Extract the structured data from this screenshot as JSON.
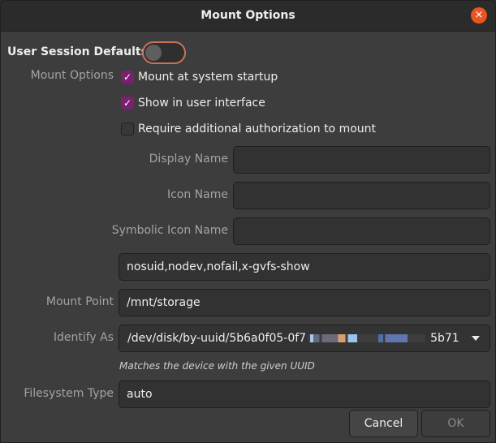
{
  "window": {
    "title": "Mount Options",
    "close_icon": "×"
  },
  "user_session_defaults": {
    "label": "User Session Defaults",
    "enabled": false
  },
  "mount_options": {
    "label": "Mount Options",
    "checkboxes": [
      {
        "label": "Mount at system startup",
        "checked": true,
        "mark": "✓"
      },
      {
        "label": "Show in user interface",
        "checked": true,
        "mark": "✓"
      },
      {
        "label": "Require additional authorization to mount",
        "checked": false,
        "mark": ""
      }
    ]
  },
  "fields": {
    "display_name": {
      "label": "Display Name",
      "value": ""
    },
    "icon_name": {
      "label": "Icon Name",
      "value": ""
    },
    "symbolic_icon_name": {
      "label": "Symbolic Icon Name",
      "value": ""
    },
    "options": {
      "value": "nosuid,nodev,nofail,x-gvfs-show"
    },
    "mount_point": {
      "label": "Mount Point",
      "value": "/mnt/storage"
    },
    "identify_as": {
      "label": "Identify As",
      "value_prefix": "/dev/disk/by-uuid/5b6a0f05-0f7",
      "value_suffix": "5b71",
      "hint": "Matches the device with the given UUID"
    },
    "filesystem_type": {
      "label": "Filesystem Type",
      "value": "auto"
    }
  },
  "buttons": {
    "cancel": "Cancel",
    "ok": "OK"
  },
  "colors": {
    "accent_close": "#e95420",
    "checkbox_checked": "#77216f",
    "switch_focus": "#c7735a"
  }
}
